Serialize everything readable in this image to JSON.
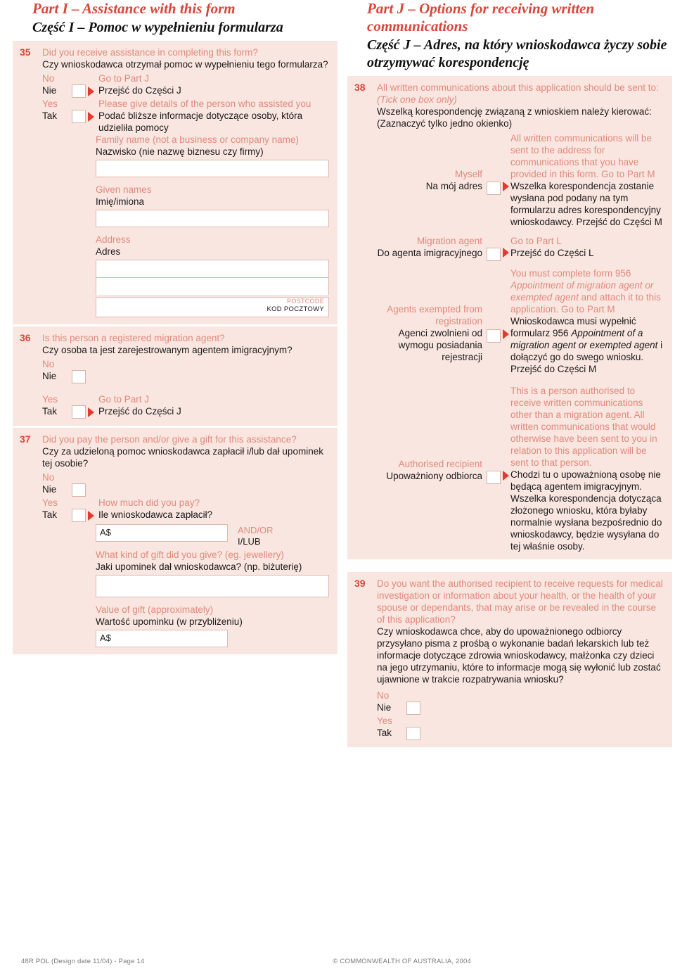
{
  "left": {
    "part": {
      "en": "Part I – Assistance with this form",
      "pl": "Część I – Pomoc w wypełnieniu formularza"
    },
    "q35": {
      "num": "35",
      "en": "Did you receive assistance in completing this form?",
      "pl": "Czy wnioskodawca otrzymał pomoc w wypełnieniu tego formularza?",
      "no_en": "No",
      "no_pl": "Nie",
      "no_goto_en": "Go to Part J",
      "no_goto_pl": "Przejść do Części J",
      "yes_en": "Yes",
      "yes_pl": "Tak",
      "yes_text_en": "Please give details of the person who assisted you",
      "yes_text_pl": "Podać bliższe informacje dotyczące osoby, która udzieliła pomocy",
      "family_en": "Family name (not a business or company name)",
      "family_pl": "Nazwisko (nie nazwę biznesu czy firmy)",
      "given_en": "Given names",
      "given_pl": "Imię/imiona",
      "address_en": "Address",
      "address_pl": "Adres",
      "postcode_en": "POSTCODE",
      "postcode_pl": "KOD POCZTOWY",
      "family_value": "",
      "given_value": "",
      "address_line1_value": "",
      "address_line2_value": "",
      "postcode_value": ""
    },
    "q36": {
      "num": "36",
      "en": "Is this person a registered migration agent?",
      "pl": "Czy osoba ta jest zarejestrowanym agentem imigracyjnym?",
      "no_en": "No",
      "no_pl": "Nie",
      "yes_en": "Yes",
      "yes_pl": "Tak",
      "yes_goto_en": "Go to Part J",
      "yes_goto_pl": "Przejść do Części J"
    },
    "q37": {
      "num": "37",
      "en": "Did you pay the person and/or give a gift for this assistance?",
      "pl": "Czy za udzieloną pomoc wnioskodawca zapłacił i/lub dał upominek tej osobie?",
      "no_en": "No",
      "no_pl": "Nie",
      "yes_en": "Yes",
      "yes_pl": "Tak",
      "howmuch_en": "How much did you pay?",
      "howmuch_pl": "Ile wnioskodawca zapłacił?",
      "amount_value": "A$",
      "andor_en": "AND/OR",
      "andor_pl": "I/LUB",
      "gift_en": "What kind of gift did you give? (eg. jewellery)",
      "gift_pl": "Jaki upominek dał wnioskodawca? (np. biżuterię)",
      "gift_value": "",
      "value_en": "Value of gift (approximately)",
      "value_pl": "Wartość upominku (w przybliżeniu)",
      "value_value": "A$"
    }
  },
  "right": {
    "part": {
      "en": "Part J – Options for receiving written communications",
      "pl": "Część J – Adres, na który wnioskodawca życzy sobie otrzymywać korespondencję"
    },
    "q38": {
      "num": "38",
      "en": "All written communications about this application should be sent to:",
      "en_tick": "(Tick one box only)",
      "pl": "Wszelką korespondencję związaną z wnioskiem należy kierować:",
      "pl_tick": "(Zaznaczyć tylko jedno okienko)",
      "options": [
        {
          "label_en": "Myself",
          "label_pl": "Na mój adres",
          "desc_en": "All written communications will be sent to the address for communications that you have provided in this form. Go to Part M",
          "desc_pl": "Wszelka korespondencja zostanie wysłana pod podany na tym formularzu adres korespondencyjny wnioskodawcy. Przejść do Części M"
        },
        {
          "label_en": "Migration agent",
          "label_pl": "Do agenta imigracyjnego",
          "desc_en": "Go to Part L",
          "desc_pl": "Przejść do Części L"
        },
        {
          "label_en": "Agents exempted from registration",
          "label_pl": "Agenci zwolnieni od wymogu posiadania rejestracji",
          "desc_en_a": "You must complete form 956 ",
          "desc_en_it": "Appointment of migration agent or exempted agent",
          "desc_en_b": " and attach it to this application. Go to Part M",
          "desc_pl_a": "Wnioskodawca musi wypełnić formularz 956 ",
          "desc_pl_it": "Appointment of a migration agent or exempted agent",
          "desc_pl_b": " i dołączyć go do swego wniosku. Przejść do Części M"
        },
        {
          "label_en": "Authorised recipient",
          "label_pl": "Upoważniony odbiorca",
          "desc_en": "This is a person authorised to receive written communications other than a migration agent. All written communications that would otherwise have been sent to you in relation to this application will be sent to that person.",
          "desc_pl": "Chodzi tu o upoważnioną osobę nie będącą agentem imigracyjnym. Wszelka korespondencja dotycząca złożonego wniosku, która byłaby normalnie wysłana bezpośrednio do wnioskodawcy, będzie wysyłana do tej właśnie osoby."
        }
      ]
    },
    "q39": {
      "num": "39",
      "en": "Do you want the authorised recipient to receive requests for medical investigation or information about your health, or the health of your spouse or dependants, that may arise or be revealed in the course of this application?",
      "pl": "Czy wnioskodawca chce, aby do upoważnionego odbiorcy przysyłano pisma z prośbą o wykonanie badań lekarskich lub też informacje dotyczące zdrowia wnioskodawcy, małżonka czy dzieci na jego utrzymaniu, które to informacje mogą się wyłonić lub zostać ujawnione w trakcie rozpatrywania wniosku?",
      "no_en": "No",
      "no_pl": "Nie",
      "yes_en": "Yes",
      "yes_pl": "Tak"
    }
  },
  "footer": {
    "left": "48R POL (Design date 11/04) - Page 14",
    "right": "© COMMONWEALTH OF AUSTRALIA, 2004"
  }
}
